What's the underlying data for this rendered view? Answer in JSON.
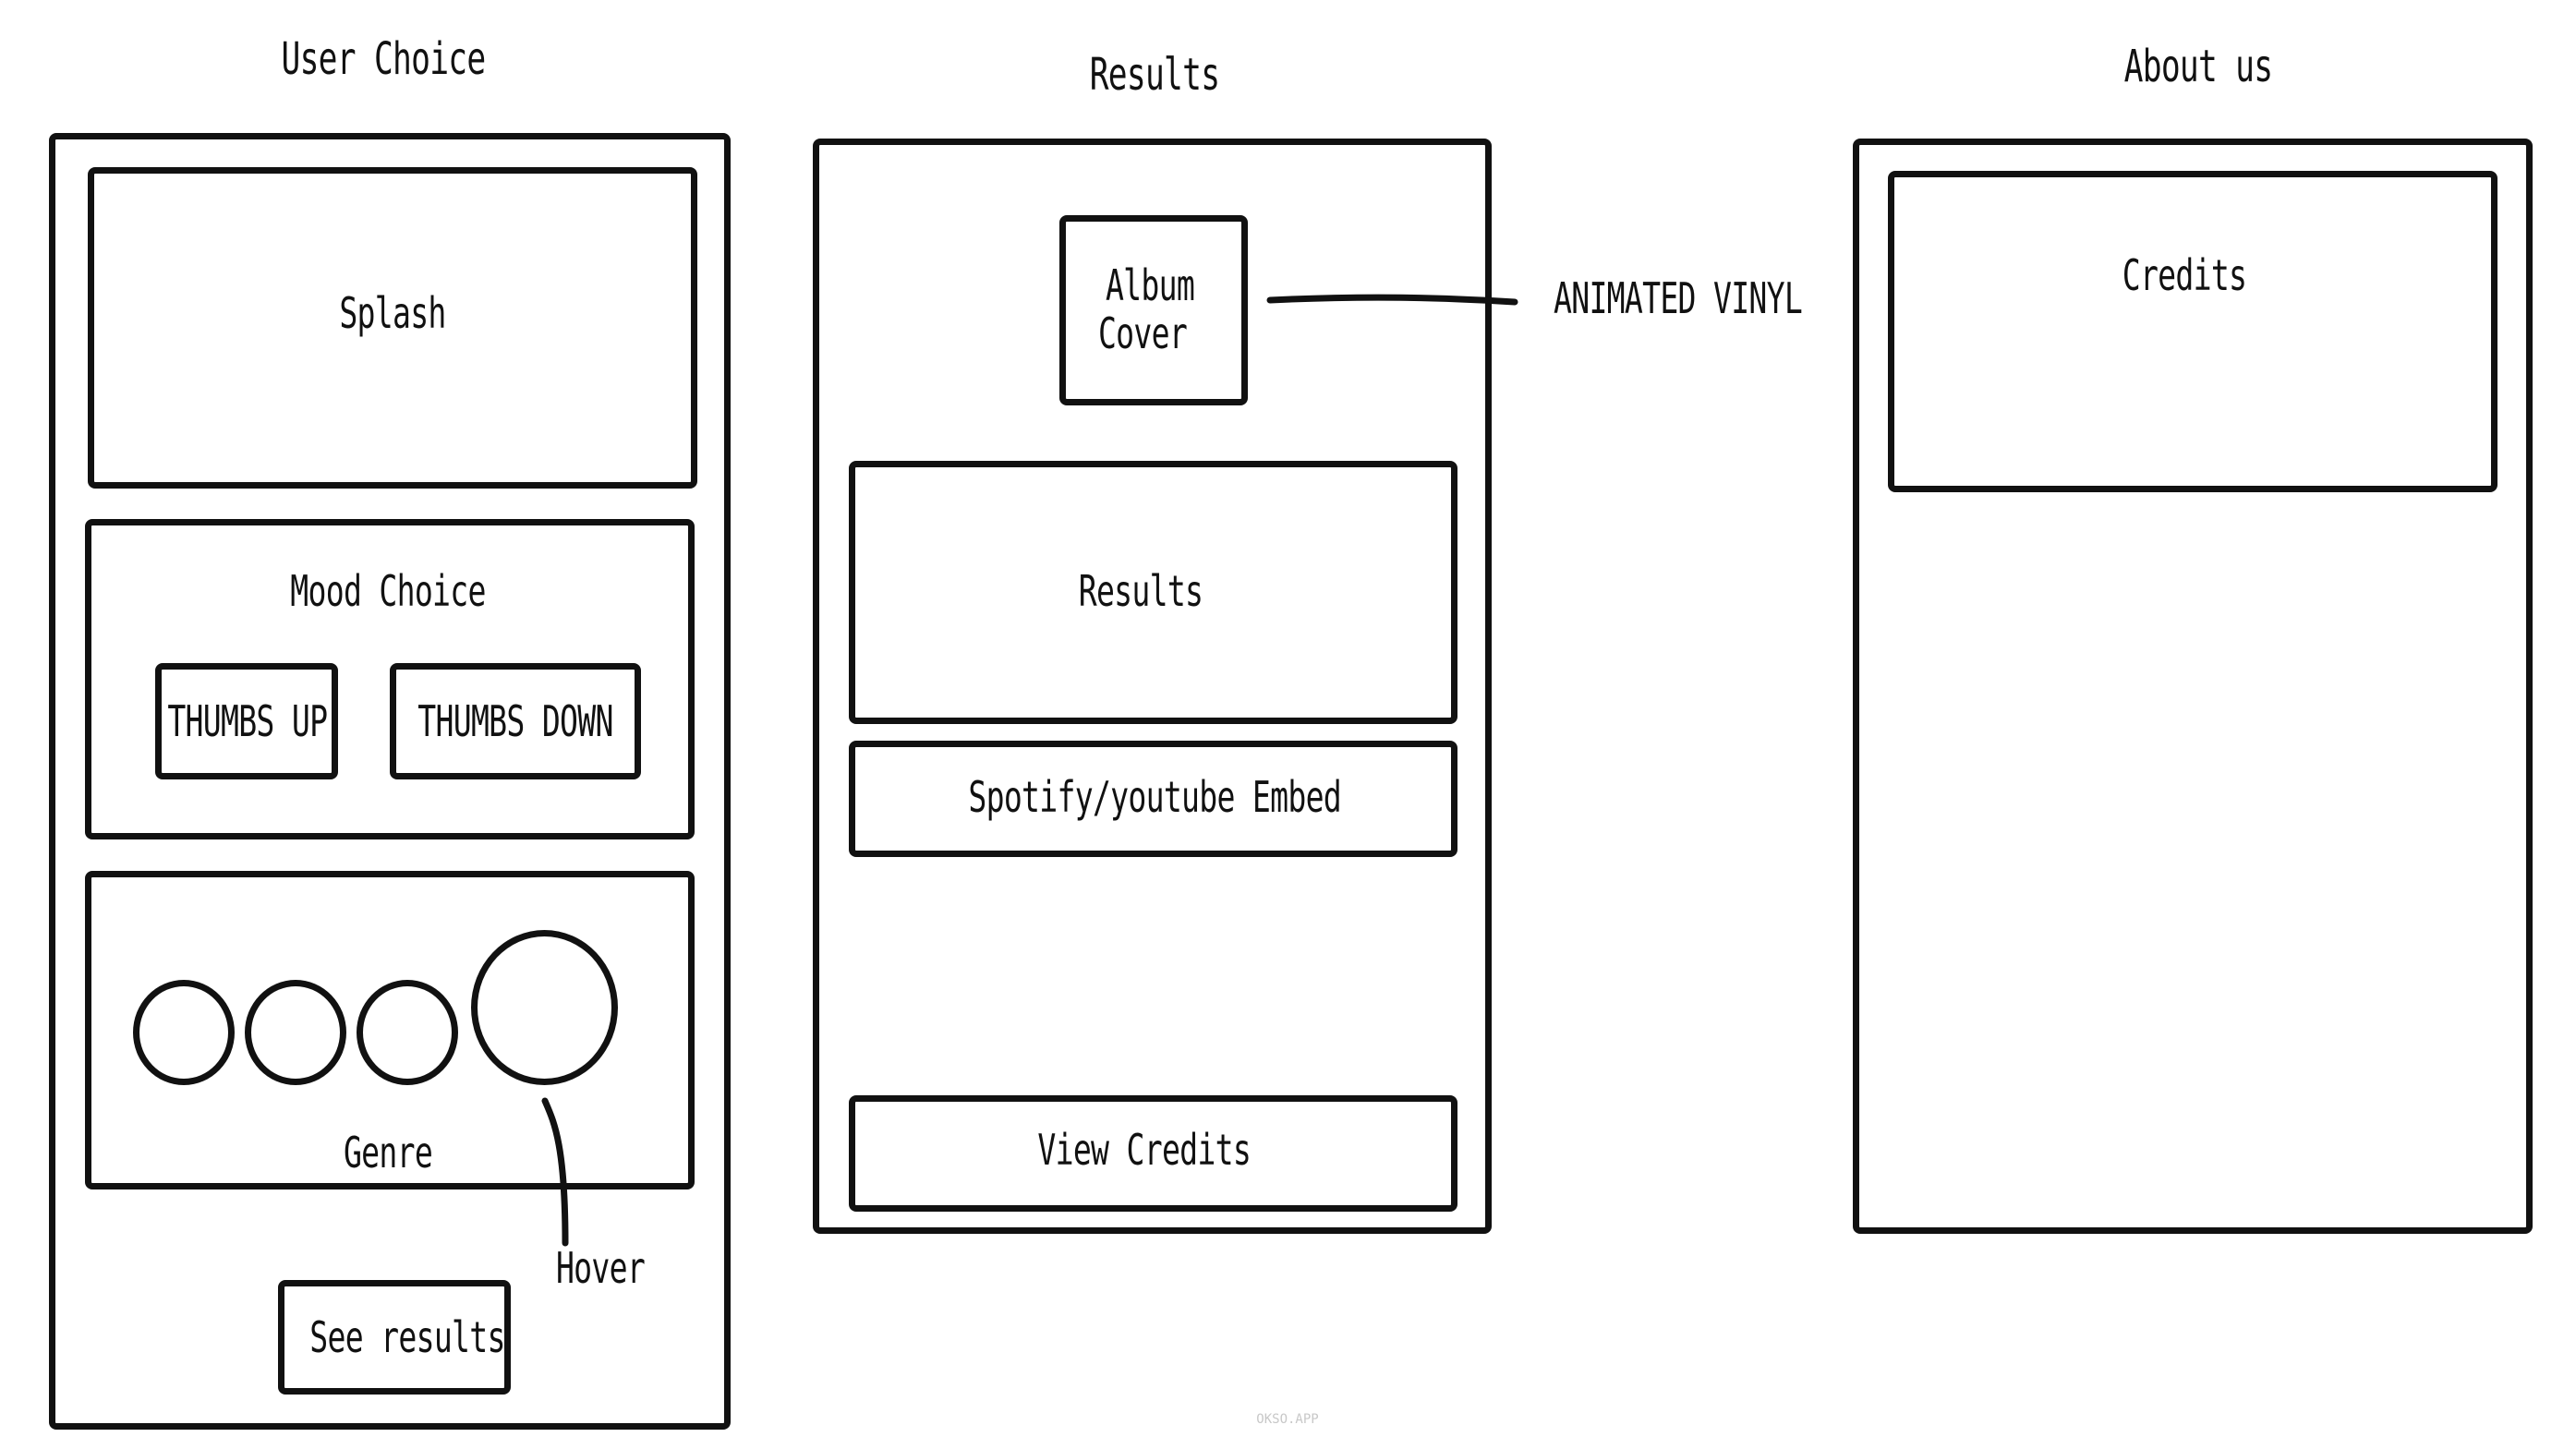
{
  "wireframes": {
    "user_choice": {
      "title": "User Choice",
      "splash": "Splash",
      "mood": {
        "heading": "Mood Choice",
        "thumbs_up": "THUMBS UP",
        "thumbs_down": "THUMBS DOWN"
      },
      "genre": {
        "label": "Genre",
        "hover_note": "Hover"
      },
      "see_results": "See results"
    },
    "results": {
      "title": "Results",
      "album_cover": [
        "Album",
        "Cover"
      ],
      "animated_note": "ANIMATED VINYL",
      "results_box": "Results",
      "embed": "Spotify/youtube Embed",
      "view_credits": "View Credits"
    },
    "about": {
      "title": "About us",
      "credits": "Credits"
    }
  },
  "watermark": "OKSO.APP"
}
